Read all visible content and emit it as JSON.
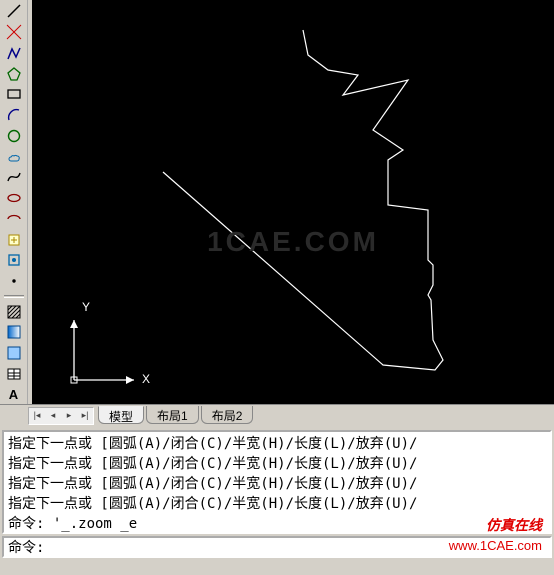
{
  "toolbar": {
    "icons": [
      "line",
      "rectangle",
      "polyline",
      "polygon",
      "arc",
      "circle",
      "revision-cloud",
      "spline",
      "ellipse",
      "ellipse-arc",
      "block",
      "point",
      "hatch",
      "gradient",
      "region",
      "table",
      "text"
    ]
  },
  "canvas": {
    "axis_x": "X",
    "axis_y": "Y",
    "watermark": "1CAE.COM"
  },
  "tabs": {
    "model": "模型",
    "layout1": "布局1",
    "layout2": "布局2"
  },
  "command_history": [
    "指定下一点或  [圆弧(A)/闭合(C)/半宽(H)/长度(L)/放弃(U)/",
    "指定下一点或  [圆弧(A)/闭合(C)/半宽(H)/长度(L)/放弃(U)/",
    "指定下一点或  [圆弧(A)/闭合(C)/半宽(H)/长度(L)/放弃(U)/",
    "指定下一点或  [圆弧(A)/闭合(C)/半宽(H)/长度(L)/放弃(U)/",
    "命令: '_.zoom _e"
  ],
  "command_prompt": "命令:",
  "watermarks": {
    "brand": "仿真在线",
    "url": "www.1CAE.com"
  }
}
